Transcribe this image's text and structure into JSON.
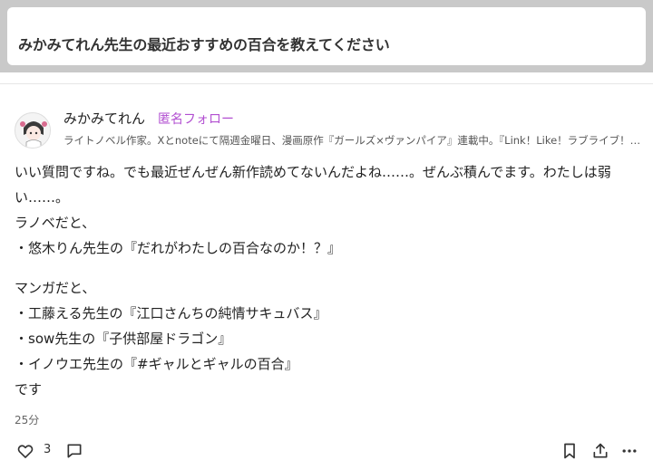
{
  "question": {
    "title": "みかみてれん先生の最近おすすめの百合を教えてください"
  },
  "author": {
    "name": "みかみてれん",
    "follow_label": "匿名フォロー",
    "bio": "ライトノベル作家。Xとnoteにて隔週金曜日、漫画原作『ガールズ×ヴァンパイア』連載中。『Link！Like！ラブライブ！蓮ノ空女学院スクールアイドルクラブ』"
  },
  "answer": {
    "lines": [
      "いい質問ですね。でも最近ぜんぜん新作読めてないんだよね……。ぜんぶ積んでます。わたしは弱い……。",
      "ラノベだと、",
      "・悠木りん先生の『だれがわたしの百合なのか！？』",
      "マンガだと、",
      "・工藤える先生の『江口さんちの純情サキュバス』",
      "・sow先生の『子供部屋ドラゴン』",
      "・イノウエ先生の『#ギャルとギャルの百合』",
      "です"
    ]
  },
  "meta": {
    "timestamp": "25分"
  },
  "actions": {
    "like_count": "3",
    "icons": [
      "heart-icon",
      "comment-icon",
      "bookmark-icon",
      "share-icon",
      "more-icon"
    ]
  },
  "colors": {
    "accent": "#b24fd1",
    "top_band": "#c9c9c9"
  }
}
